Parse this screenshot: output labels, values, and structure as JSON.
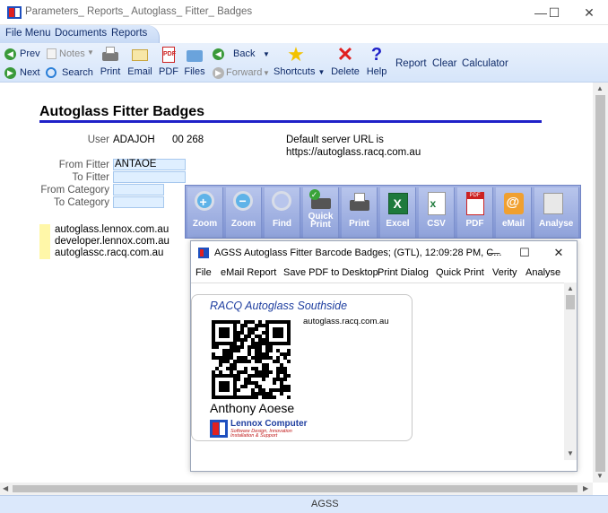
{
  "window": {
    "title": "Parameters_ Reports_ Autoglass_ Fitter_ Badges",
    "minimize": "—",
    "maximize": "☐",
    "close": "✕"
  },
  "menu": {
    "items": [
      "File Menu",
      "Documents",
      "Reports"
    ]
  },
  "toolbar": {
    "prev": "Prev",
    "next": "Next",
    "notes": "Notes",
    "search": "Search",
    "print": "Print",
    "email": "Email",
    "pdf": "PDF",
    "files": "Files",
    "back": "Back",
    "forward": "Forward",
    "shortcuts": "Shortcuts",
    "delete": "Delete",
    "help": "Help",
    "report": "Report",
    "clear": "Clear",
    "calculator": "Calculator"
  },
  "form": {
    "title": "Autoglass Fitter Badges",
    "user_label": "User",
    "user_value": "ADAJOH",
    "user_code": "00 268",
    "server_url_label": "Default server URL is",
    "server_url": "https://autoglass.racq.com.au",
    "from_fitter_label": "From Fitter",
    "from_fitter_value": "ANTAOE",
    "to_fitter_label": "To Fitter",
    "to_fitter_value": "",
    "from_category_label": "From Category",
    "from_category_value": "",
    "to_category_label": "To Category",
    "to_category_value": "",
    "urls": [
      "autoglass.lennox.com.au",
      "developer.lennox.com.au",
      "autoglassc.racq.com.au"
    ]
  },
  "viewer_toolbar": {
    "buttons": [
      "Zoom",
      "Zoom",
      "Find",
      "Quick Print",
      "Print",
      "Excel",
      "CSV",
      "PDF",
      "eMail",
      "Analyse"
    ]
  },
  "preview": {
    "title": "AGSS Autoglass Fitter Barcode Badges; (GTL), 12:09:28 PM, C...",
    "menu": [
      "File",
      "eMail Report",
      "Save PDF to Desktop",
      "Print Dialog",
      "Quick Print",
      "Verity",
      "Analyse"
    ],
    "badge": {
      "heading": "RACQ Autoglass Southside",
      "site": "autoglass.racq.com.au",
      "name": "Anthony Aoese",
      "company": "Lennox Computer",
      "tagline1": "Software Design, Innovation",
      "tagline2": "Installation & Support"
    }
  },
  "status": {
    "text": "AGSS"
  }
}
